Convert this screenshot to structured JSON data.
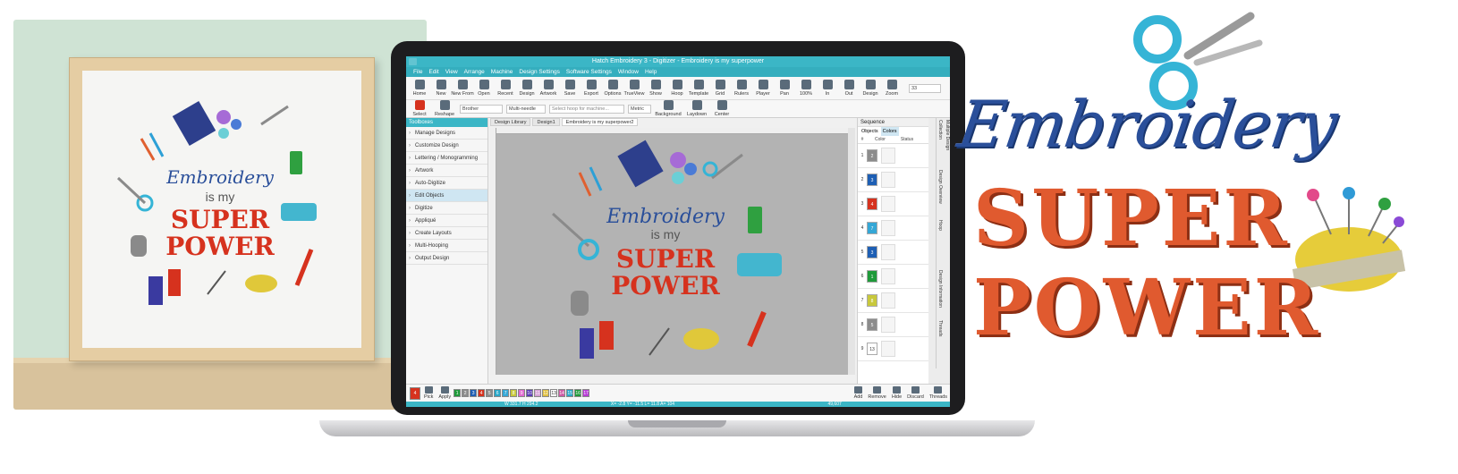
{
  "app": {
    "title": "Hatch Embroidery 3 - Digitizer - Embroidery is my superpower",
    "menu": [
      "File",
      "Edit",
      "View",
      "Arrange",
      "Machine",
      "Design Settings",
      "Software Settings",
      "Window",
      "Help"
    ],
    "toolbar1": [
      "Home",
      "New",
      "New From",
      "Open",
      "Recent",
      "Design",
      "Artwork",
      "Save",
      "Export",
      "Options",
      "TrueView",
      "Show",
      "Hoop",
      "Template",
      "Grid",
      "Rulers",
      "Player",
      "Pan",
      "100%",
      "In",
      "Out",
      "Design",
      "Zoom"
    ],
    "zoom_value": "33",
    "toolbar2": {
      "select": "Select",
      "reshape": "Reshape",
      "machine_brand": "Brother",
      "needle": "Multi-needle",
      "hoop_placeholder": "Select hoop for machine...",
      "unit": "Metric",
      "background": "Background",
      "laydown": "Laydown",
      "center": "Center"
    },
    "toolboxes": {
      "title": "Toolboxes",
      "items": [
        "Manage Designs",
        "Customize Design",
        "Lettering / Monogramming",
        "Artwork",
        "Auto-Digitize",
        "Edit Objects",
        "Digitize",
        "Appliqué",
        "Create Layouts",
        "Multi-Hooping",
        "Output Design"
      ],
      "selected_index": 5
    },
    "doc_tabs": [
      "Design Library",
      "Design1",
      "Embroidery is my superpower2"
    ],
    "sequence": {
      "title": "Sequence",
      "tabs": [
        "Objects",
        "Colors"
      ],
      "columns": [
        "#",
        "Color",
        "Status"
      ],
      "rows": [
        {
          "num": "1",
          "color": "#8c8c8c",
          "label": "2"
        },
        {
          "num": "2",
          "color": "#1e5fb4",
          "label": "3"
        },
        {
          "num": "3",
          "color": "#d6321e",
          "label": "4"
        },
        {
          "num": "4",
          "color": "#35a7d6",
          "label": "7"
        },
        {
          "num": "5",
          "color": "#1e5fb4",
          "label": "3"
        },
        {
          "num": "6",
          "color": "#1f9a3a",
          "label": "1"
        },
        {
          "num": "7",
          "color": "#c8c83c",
          "label": "8"
        },
        {
          "num": "8",
          "color": "#8c8c8c",
          "label": "5"
        },
        {
          "num": "9",
          "color": "#ffffff",
          "label": "13"
        }
      ]
    },
    "side_tabs": [
      "Multiple Design Collection",
      "Design Overview",
      "Hoop",
      "Design Information",
      "Threads"
    ],
    "palette": {
      "current": {
        "label": "4",
        "color": "#d6321e"
      },
      "pick": "Pick",
      "apply": "Apply",
      "swatches": [
        {
          "label": "1",
          "color": "#1f9a3a"
        },
        {
          "label": "2",
          "color": "#8c8c8c"
        },
        {
          "label": "3",
          "color": "#1e5fb4"
        },
        {
          "label": "4",
          "color": "#d6321e"
        },
        {
          "label": "5",
          "color": "#8c8c8c"
        },
        {
          "label": "6",
          "color": "#2aa7c8"
        },
        {
          "label": "7",
          "color": "#35a7d6"
        },
        {
          "label": "8",
          "color": "#c8c83c"
        },
        {
          "label": "9",
          "color": "#e06ad0"
        },
        {
          "label": "10",
          "color": "#5a3ab4"
        },
        {
          "label": "11",
          "color": "#d6a0d6"
        },
        {
          "label": "12",
          "color": "#e0c040"
        },
        {
          "label": "13",
          "color": "#ffffff"
        },
        {
          "label": "14",
          "color": "#cf5aa6"
        },
        {
          "label": "15",
          "color": "#2aa7c8"
        },
        {
          "label": "16",
          "color": "#1f9a3a"
        },
        {
          "label": "17",
          "color": "#b73ad6"
        }
      ],
      "buttons": [
        "Add",
        "Remove",
        "Hide",
        "Discard",
        "Threads"
      ]
    },
    "status": {
      "size": "W 331.7 H 294.2",
      "coords": "X= -2.8 Y= -11.5 L= 11.8 A= 104",
      "stitches": "49,607"
    }
  },
  "art": {
    "line1": "Embroidery",
    "line2": "is my",
    "line3": "SUPER",
    "line4": "POWER"
  },
  "colors": {
    "accent": "#3bb6c6",
    "emb_blue": "#2a4f9a",
    "super_orange": "#e05a2f"
  }
}
